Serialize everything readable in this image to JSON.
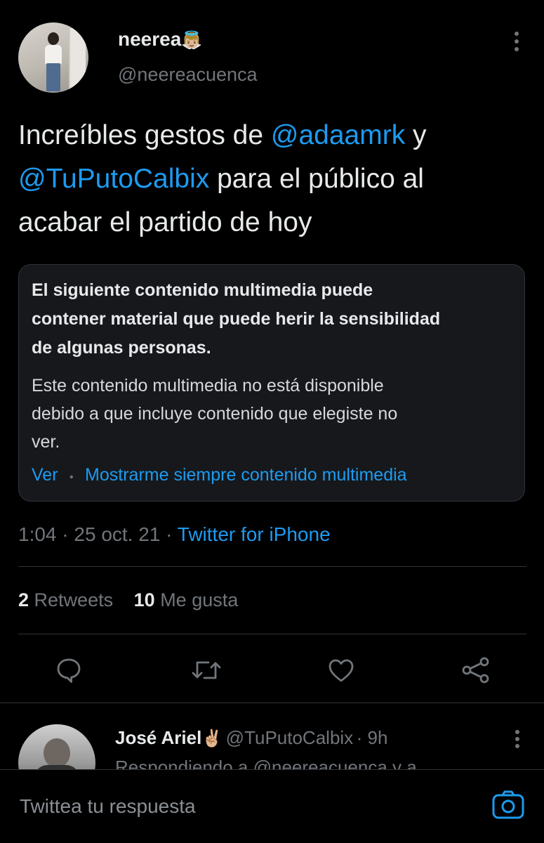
{
  "tweet": {
    "author_name": "neerea",
    "author_emoji": "👼🏼",
    "author_handle": "@neereacuenca",
    "text_part1": "Increíbles gestos de ",
    "mention1": "@adaamrk",
    "text_part2": "  y",
    "mention2": "@TuPutoCalbix",
    "text_part3": "  para el público al",
    "text_part4": "acabar el partido de hoy",
    "sensitive": {
      "title_line1": "El siguiente contenido multimedia puede",
      "title_line2": "contener material que puede herir la sensibilidad",
      "title_line3": "de algunas personas.",
      "body_line1": "Este contenido multimedia no está disponible",
      "body_line2": "debido a que incluye contenido que elegiste no",
      "body_line3": "ver.",
      "view_label": "Ver",
      "separator": "•",
      "always_show_label": "Mostrarme siempre contenido multimedia"
    },
    "time": "1:04",
    "date": "25 oct. 21",
    "meta_sep": "·",
    "source": "Twitter for iPhone",
    "retweets_count": "2",
    "retweets_label": "Retweets",
    "likes_count": "10",
    "likes_label": "Me gusta"
  },
  "actions": [
    {
      "icon": "reply-icon"
    },
    {
      "icon": "retweet-icon"
    },
    {
      "icon": "like-icon"
    },
    {
      "icon": "share-icon"
    }
  ],
  "reply": {
    "author_name": "José Ariel",
    "author_emoji": "✌🏼",
    "author_handle": "@TuPutoCalbix",
    "time": "· 9h",
    "partial_text": "Respondiendo a @neereacuenca y a"
  },
  "composer": {
    "placeholder": "Twittea tu respuesta",
    "camera_icon": "camera-icon"
  },
  "colors": {
    "accent": "#1d9bf0",
    "background": "#000000",
    "secondary_text": "#71767b",
    "card_background": "#16181c"
  }
}
